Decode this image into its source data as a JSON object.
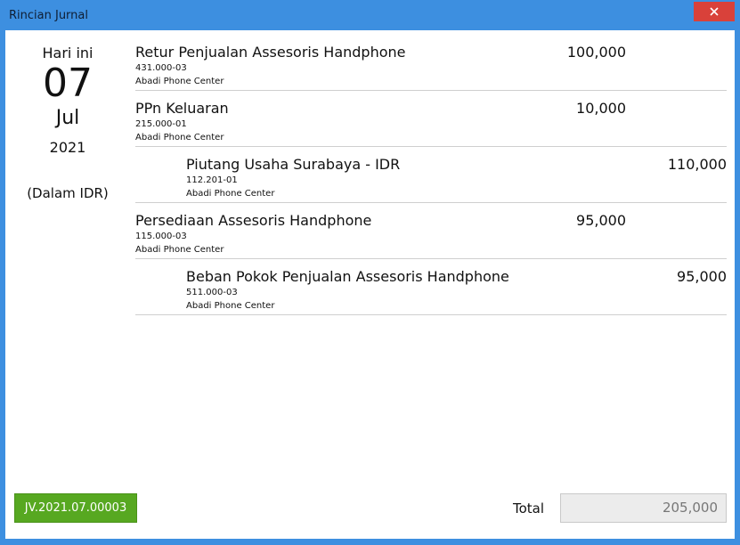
{
  "window": {
    "title": "Rincian Jurnal",
    "close_icon": "close-icon"
  },
  "date_panel": {
    "today_label": "Hari ini",
    "day": "07",
    "month": "Jul",
    "year": "2021",
    "currency_note": "(Dalam IDR)"
  },
  "entries": [
    {
      "name": "Retur Penjualan Assesoris Handphone",
      "code": "431.000-03",
      "company": "Abadi Phone Center",
      "debit": "100,000",
      "credit": ""
    },
    {
      "name": "PPn Keluaran",
      "code": "215.000-01",
      "company": "Abadi Phone Center",
      "debit": "10,000",
      "credit": ""
    },
    {
      "name": "Piutang Usaha Surabaya - IDR",
      "code": "112.201-01",
      "company": "Abadi Phone Center",
      "debit": "",
      "credit": "110,000"
    },
    {
      "name": "Persediaan Assesoris Handphone",
      "code": "115.000-03",
      "company": "Abadi Phone Center",
      "debit": "95,000",
      "credit": ""
    },
    {
      "name": "Beban Pokok Penjualan Assesoris Handphone",
      "code": "511.000-03",
      "company": "Abadi Phone Center",
      "debit": "",
      "credit": "95,000"
    }
  ],
  "footer": {
    "journal_number": "JV.2021.07.00003",
    "total_label": "Total",
    "total_value": "205,000"
  },
  "colors": {
    "titlebar": "#3d8fe0",
    "close": "#d9413a",
    "button": "#57a821"
  }
}
